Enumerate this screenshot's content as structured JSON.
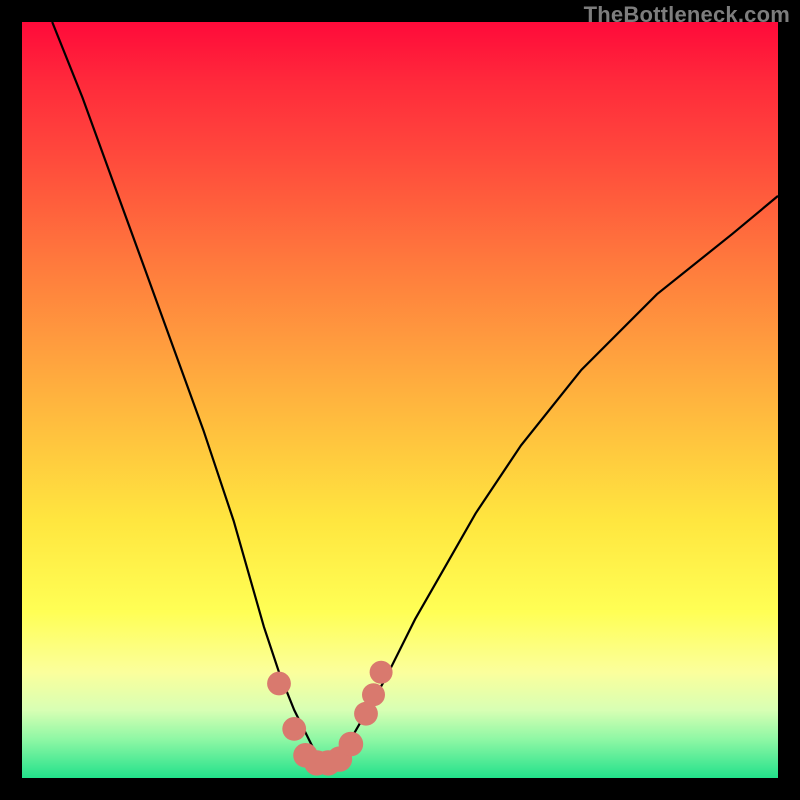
{
  "watermark": "TheBottleneck.com",
  "chart_data": {
    "type": "line",
    "title": "",
    "xlabel": "",
    "ylabel": "",
    "xlim": [
      0,
      100
    ],
    "ylim": [
      0,
      100
    ],
    "series": [
      {
        "name": "bottleneck-curve",
        "x": [
          4,
          8,
          12,
          16,
          20,
          24,
          28,
          30,
          32,
          34,
          36,
          38,
          39,
          40,
          41,
          42,
          44,
          48,
          52,
          56,
          60,
          66,
          74,
          84,
          94,
          100
        ],
        "y": [
          100,
          90,
          79,
          68,
          57,
          46,
          34,
          27,
          20,
          14,
          9,
          5,
          3,
          2,
          2,
          3,
          6,
          13,
          21,
          28,
          35,
          44,
          54,
          64,
          72,
          77
        ]
      }
    ],
    "markers": {
      "name": "highlight-dots",
      "color": "#d9796e",
      "points": [
        {
          "x": 34.0,
          "y": 12.5,
          "r": 1.3
        },
        {
          "x": 36.0,
          "y": 6.5,
          "r": 1.3
        },
        {
          "x": 37.5,
          "y": 3.0,
          "r": 1.4
        },
        {
          "x": 39.0,
          "y": 2.0,
          "r": 1.5
        },
        {
          "x": 40.5,
          "y": 2.0,
          "r": 1.5
        },
        {
          "x": 42.0,
          "y": 2.5,
          "r": 1.5
        },
        {
          "x": 43.5,
          "y": 4.5,
          "r": 1.4
        },
        {
          "x": 45.5,
          "y": 8.5,
          "r": 1.3
        },
        {
          "x": 46.5,
          "y": 11.0,
          "r": 1.2
        },
        {
          "x": 47.5,
          "y": 14.0,
          "r": 1.2
        }
      ]
    }
  }
}
